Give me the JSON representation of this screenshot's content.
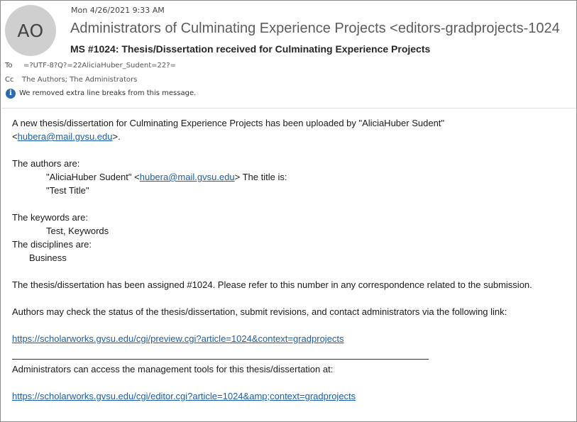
{
  "header": {
    "avatar_initials": "AO",
    "date": "Mon 4/26/2021 9:33 AM",
    "sender": "Administrators of Culminating Experience Projects <editors-gradprojects-1024",
    "subject": "MS #1024: Thesis/Dissertation received for Culminating Experience Projects",
    "to_label": "To",
    "to_value": "=?UTF-8?Q?=22AliciaHuber_Sudent=22?=",
    "cc_label": "Cc",
    "cc_value": "The Authors; The Administrators",
    "info_icon": "info-icon",
    "info_text": "We removed extra line breaks from this message."
  },
  "body": {
    "line1": "A new thesis/dissertation for Culminating Experience Projects has been uploaded by \"AliciaHuber Sudent\"",
    "line2_open": "<",
    "email": "hubera@mail.gvsu.edu",
    "line2_close": ">.",
    "authors_heading": "The authors are:",
    "author_name": "\"AliciaHuber Sudent\" <",
    "author_after": "> The title is:",
    "title": "\"Test Title\"",
    "keywords_heading": "The keywords are:",
    "keywords": "Test, Keywords",
    "disciplines_heading": "The disciplines are:",
    "discipline": "Business",
    "assigned": "The thesis/dissertation has been assigned #1024. Please refer to this number in any correspondence related to the submission.",
    "authors_may": "Authors may check the status of the thesis/dissertation, submit revisions, and contact administrators via the following link:",
    "preview_link": "https://scholarworks.gvsu.edu/cgi/preview.cgi?article=1024&context=gradprojects",
    "admins_can": "Administrators can access the management tools for this thesis/dissertation at:",
    "editor_link": "https://scholarworks.gvsu.edu/cgi/editor.cgi?article=1024&amp;context=gradprojects"
  }
}
